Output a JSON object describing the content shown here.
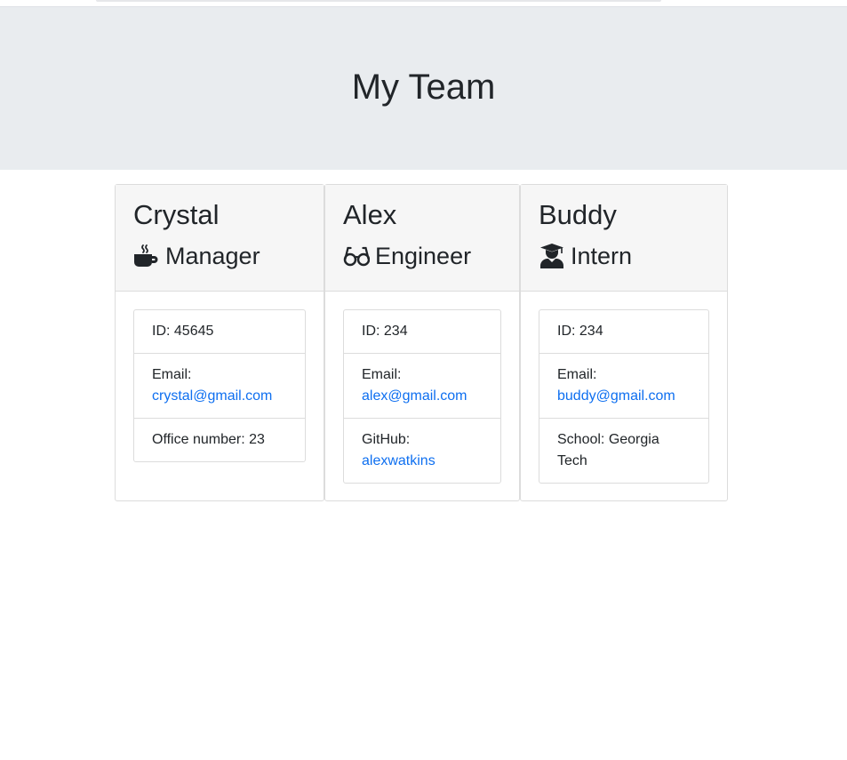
{
  "header": {
    "title": "My Team"
  },
  "team": [
    {
      "name": "Crystal",
      "role": "Manager",
      "icon": "coffee-icon",
      "id_text": "ID: 45645",
      "email_label": "Email:",
      "email": "crystal@gmail.com",
      "extra_text": "Office number: 23"
    },
    {
      "name": "Alex",
      "role": "Engineer",
      "icon": "glasses-icon",
      "id_text": "ID: 234",
      "email_label": "Email:",
      "email": "alex@gmail.com",
      "extra_label": "GitHub:",
      "extra_link": "alexwatkins"
    },
    {
      "name": "Buddy",
      "role": "Intern",
      "icon": "graduate-icon",
      "id_text": "ID: 234",
      "email_label": "Email:",
      "email": "buddy@gmail.com",
      "extra_text": "School: Georgia Tech"
    }
  ],
  "colors": {
    "link": "#0e6ff0",
    "header_bg": "#e9ecef",
    "card_header_bg": "#f6f6f6"
  }
}
